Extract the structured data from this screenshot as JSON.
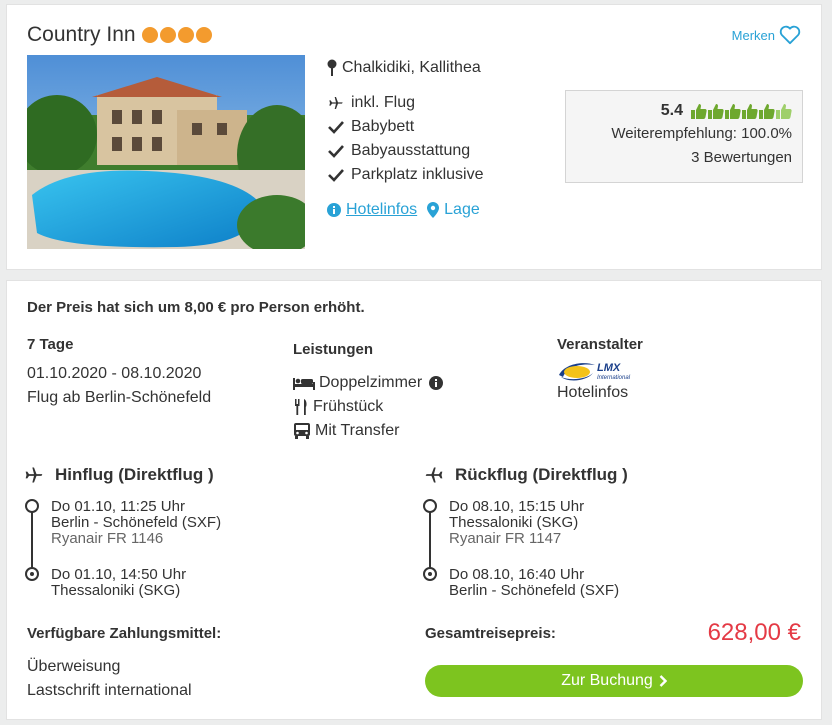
{
  "hotel": {
    "name": "Country Inn",
    "stars": 4,
    "merken_label": "Merken",
    "location": "Chalkidiki, Kallithea",
    "features": [
      {
        "icon": "plane-icon",
        "label": "inkl. Flug"
      },
      {
        "icon": "check-icon",
        "label": "Babybett"
      },
      {
        "icon": "check-icon",
        "label": "Babyausstattung"
      },
      {
        "icon": "check-icon",
        "label": "Parkplatz inklusive"
      }
    ],
    "link_hotelinfos": "Hotelinfos",
    "link_lage": "Lage",
    "rating": {
      "score": "5.4",
      "thumbs_full": 6,
      "thumbs_total": 6,
      "recommendation": "Weiterempfehlung: 100.0%",
      "reviews": "3 Bewertungen"
    }
  },
  "offer": {
    "price_change": "Der Preis hat sich um 8,00 € pro Person erhöht.",
    "duration": "7 Tage",
    "dates": "01.10.2020 - 08.10.2020",
    "departure": "Flug ab Berlin-Schönefeld",
    "leistungen_title": "Leistungen",
    "leistungen": [
      {
        "icon": "bed-icon",
        "label": "Doppelzimmer"
      },
      {
        "icon": "cutlery-icon",
        "label": "Frühstück"
      },
      {
        "icon": "bus-icon",
        "label": "Mit Transfer"
      }
    ],
    "veranstalter_title": "Veranstalter",
    "veranstalter_logo": "LMX International",
    "veranstalter_link": "Hotelinfos"
  },
  "outbound": {
    "title": "Hinflug (Direktflug )",
    "dep_time": "Do 01.10, 11:25 Uhr",
    "dep_airport": "Berlin - Schönefeld (SXF)",
    "airline": "Ryanair FR 1146",
    "arr_time": "Do 01.10, 14:50 Uhr",
    "arr_airport": "Thessaloniki (SKG)"
  },
  "inbound": {
    "title": "Rückflug (Direktflug )",
    "dep_time": "Do 08.10, 15:15 Uhr",
    "dep_airport": "Thessaloniki (SKG)",
    "airline": "Ryanair FR 1147",
    "arr_time": "Do 08.10, 16:40 Uhr",
    "arr_airport": "Berlin - Schönefeld (SXF)"
  },
  "payment": {
    "title": "Verfügbare Zahlungsmittel:",
    "methods": [
      "Überweisung",
      "Lastschrift international"
    ]
  },
  "total": {
    "label": "Gesamtreisepreis:",
    "price": "628,00 €",
    "button": "Zur Buchung"
  },
  "colors": {
    "accent": "#29a2d6",
    "star": "#f39b2e",
    "thumb": "#6ea82e",
    "price": "#e43a45",
    "button": "#7dc41f"
  }
}
